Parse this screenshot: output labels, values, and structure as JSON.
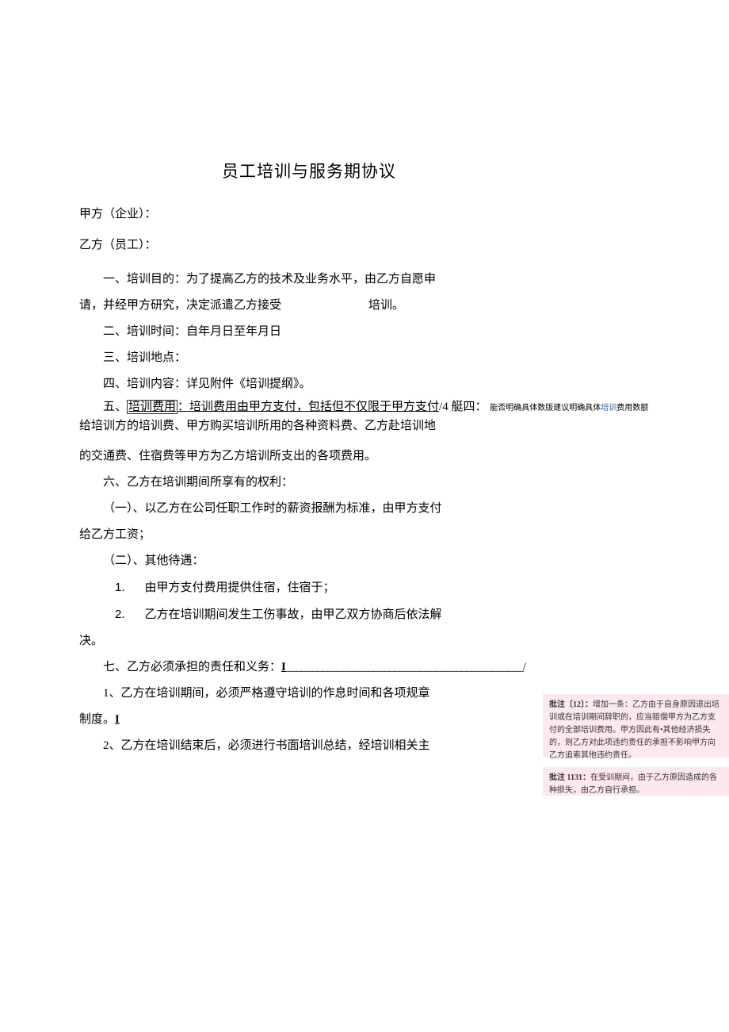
{
  "title": "员工培训与服务期协议",
  "partyA": "甲方（企业）：",
  "partyB": "乙方（员工）：",
  "s1a": "一、培训目的：为了提高乙方的技术及业务水平，由乙方自愿申",
  "s1b_pre": "请，并经甲方研究，决定派遣乙方接受",
  "s1b_post": "培训。",
  "s2": "二、培训时间：自年月日至年月日",
  "s3": "三、培训地点：",
  "s4": "四、培训内容：详见附件《培训提纲》。",
  "s5_label": "五、",
  "s5_box": "培训费用",
  "s5_und": "：培训费用由甲方支付，包括但不仅限于甲方支付",
  "s5_tail": "/4 艇四：",
  "s5_note": "能否明确具体数版建议明确具体",
  "s5_note_blue": "培训",
  "s5_note_end": "费用数额",
  "s5b": "给培训方的培训费、甲方购买培训所用的各种资料费、乙方赴培训地",
  "s5c": "的交通费、住宿费等甲方为乙方培训所支出的各项费用。",
  "s6": "六、乙方在培训期间所享有的权利：",
  "s6_1": "（一）、以乙方在公司任职工作时的薪资报酬为标准，由甲方支付",
  "s6_1b": "给乙方工资；",
  "s6_2": "（二）、其他待遇：",
  "li1_num": "1.",
  "li1": "由甲方支付费用提供住宿，住宿于；",
  "li2_num": "2.",
  "li2": "乙方在培训期间发生工伤事故，由甲乙双方协商后依法解",
  "li2b": "决。",
  "s7_pre": "七、乙方必须承担的责任和义务：",
  "s7_line": "______________________________________________",
  "s7_end": "/",
  "s7_1": "1、乙方在培训期间，必须严格遵守培训的作息时间和各项规章",
  "s7_1b_pre": "制度。",
  "s7_1b_cursor": "I",
  "s7_2": "2、乙方在培训结束后，必须进行书面培训总结，经培训相关主",
  "comment1_label": "批注〔12〕：",
  "comment1_text": "增加一条：乙方由于自身原因退出培训或在培训期间辞职的，应当赔偿甲方为乙方支付的全部培训费用。甲方因此有•其他经济损失的，则乙方对此项违约责任的承担不影响甲方向乙方追索其他违约责任。",
  "comment2_label": "批注 1131：",
  "comment2_text": "在受训期间，由于乙方原因造成的各种损失，由乙方自行承担。"
}
